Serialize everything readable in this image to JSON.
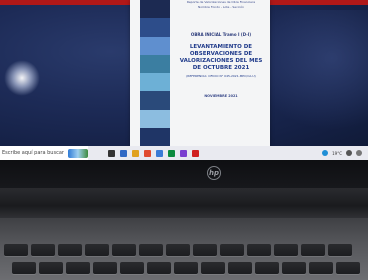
{
  "document": {
    "meta_line_1": "Reporte de Valorizaciones de Obra Financiera",
    "meta_line_2": "Nombre Fondo - Lote - Sección",
    "area": "OBRA INICIAL Tramo I (D-I)",
    "title": "LEVANTAMIENTO DE OBSERVACIONES DE VALORIZACIONES DEL MES DE OCTUBRE 2021",
    "subtitle": "(REFERENCIA: OFICIO N° 045-2021-MPC/CA-U)",
    "date": "NOVIEMBRE 2021",
    "stripe_colors": [
      "#1c2a52",
      "#2d4d8a",
      "#5f8fcf",
      "#3b7ea1",
      "#6db0d6",
      "#2a4a7a",
      "#8cbde0",
      "#1f3566"
    ]
  },
  "taskbar": {
    "search_text": "Escribe aquí para buscar",
    "icon_colors": [
      "#333333",
      "#2f68c4",
      "#e0a21f",
      "#e04a2f",
      "#3a7bd5",
      "#0b8a3e",
      "#7a3fd0",
      "#d02020"
    ],
    "tray_text": "19°C"
  },
  "laptop": {
    "logo": "hp"
  }
}
